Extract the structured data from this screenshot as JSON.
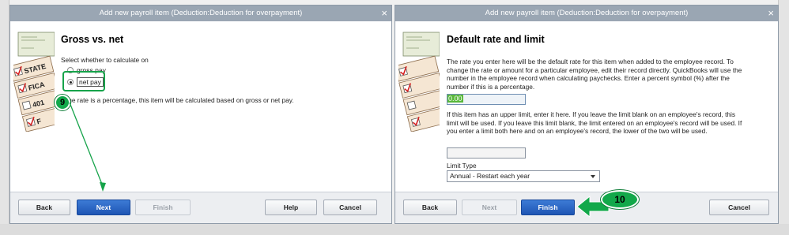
{
  "dialog1": {
    "title": "Add new payroll item (Deduction:Deduction for overpayment)",
    "close_glyph": "×",
    "art_labels": [
      "STATE",
      "FICA",
      "401",
      "F"
    ],
    "step_title": "Gross vs. net",
    "prompt": "Select whether to calculate on",
    "options": [
      {
        "label": "gross pay",
        "selected": false
      },
      {
        "label": "net pay",
        "selected": true
      }
    ],
    "note": "If the rate is a percentage, this item will be calculated based on gross or net pay.",
    "buttons": {
      "back": "Back",
      "next": "Next",
      "finish": "Finish",
      "help": "Help",
      "cancel": "Cancel"
    },
    "annotation_step": "9"
  },
  "dialog2": {
    "title": "Add new payroll item (Deduction:Deduction for overpayment)",
    "close_glyph": "×",
    "step_title": "Default rate and limit",
    "rate_text": "The rate you enter here will be the default rate for this item when added to the employee record. To change the rate or amount for a particular employee, edit their record directly.  QuickBooks will use the number in the employee record when calculating paychecks.  Enter a percent symbol (%) after the number if this is a percentage.",
    "rate_value": "0.00",
    "limit_text": "If this item has an upper limit, enter it here. If you leave the limit blank on an employee's record, this limit will be used.  If you leave this limit blank, the limit entered on an employee's record will be used.  If you enter a limit both here and on an employee's  record, the lower of the two will be used.",
    "limit_value": "",
    "limit_type_label": "Limit Type",
    "limit_type_value": "Annual - Restart each year",
    "buttons": {
      "back": "Back",
      "next": "Next",
      "finish": "Finish",
      "cancel": "Cancel"
    },
    "annotation_step": "10"
  },
  "colors": {
    "annotation_green": "#12a84a",
    "primary_button": "#1e55b3",
    "titlebar": "#9aa6b3"
  }
}
